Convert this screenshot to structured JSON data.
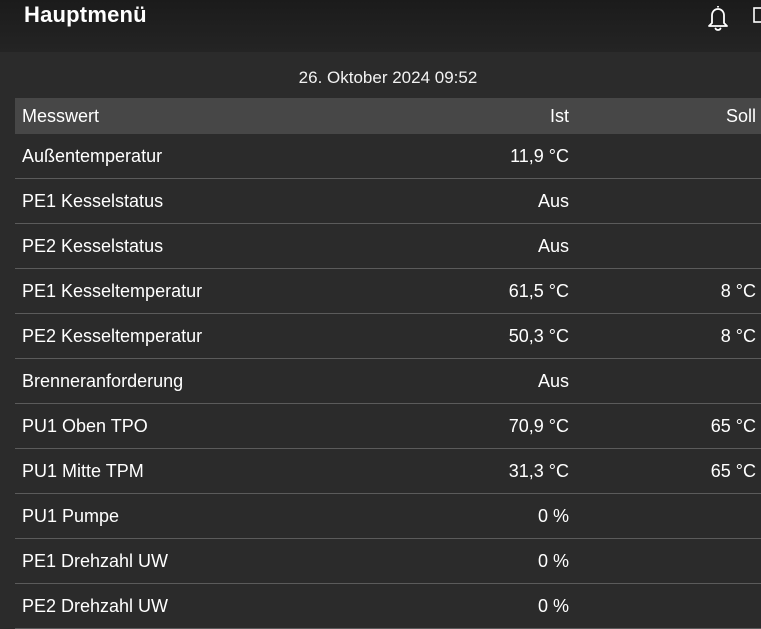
{
  "header": {
    "title": "Hauptmenü"
  },
  "datetime": "26. Oktober 2024 09:52",
  "table": {
    "columns": [
      "Messwert",
      "Ist",
      "Soll"
    ],
    "rows": [
      {
        "name": "Außentemperatur",
        "ist": "11,9 °C",
        "soll": ""
      },
      {
        "name": "PE1 Kesselstatus",
        "ist": "Aus",
        "soll": ""
      },
      {
        "name": "PE2 Kesselstatus",
        "ist": "Aus",
        "soll": ""
      },
      {
        "name": "PE1 Kesseltemperatur",
        "ist": "61,5 °C",
        "soll": "8 °C"
      },
      {
        "name": "PE2 Kesseltemperatur",
        "ist": "50,3 °C",
        "soll": "8 °C"
      },
      {
        "name": "Brenneranforderung",
        "ist": "Aus",
        "soll": ""
      },
      {
        "name": "PU1 Oben TPO",
        "ist": "70,9 °C",
        "soll": "65 °C"
      },
      {
        "name": "PU1 Mitte TPM",
        "ist": "31,3 °C",
        "soll": "65 °C"
      },
      {
        "name": "PU1 Pumpe",
        "ist": "0 %",
        "soll": ""
      },
      {
        "name": "PE1 Drehzahl UW",
        "ist": "0 %",
        "soll": ""
      },
      {
        "name": "PE2 Drehzahl UW",
        "ist": "0 %",
        "soll": ""
      }
    ]
  },
  "icons": [
    "bell-icon",
    "panel-icon"
  ]
}
